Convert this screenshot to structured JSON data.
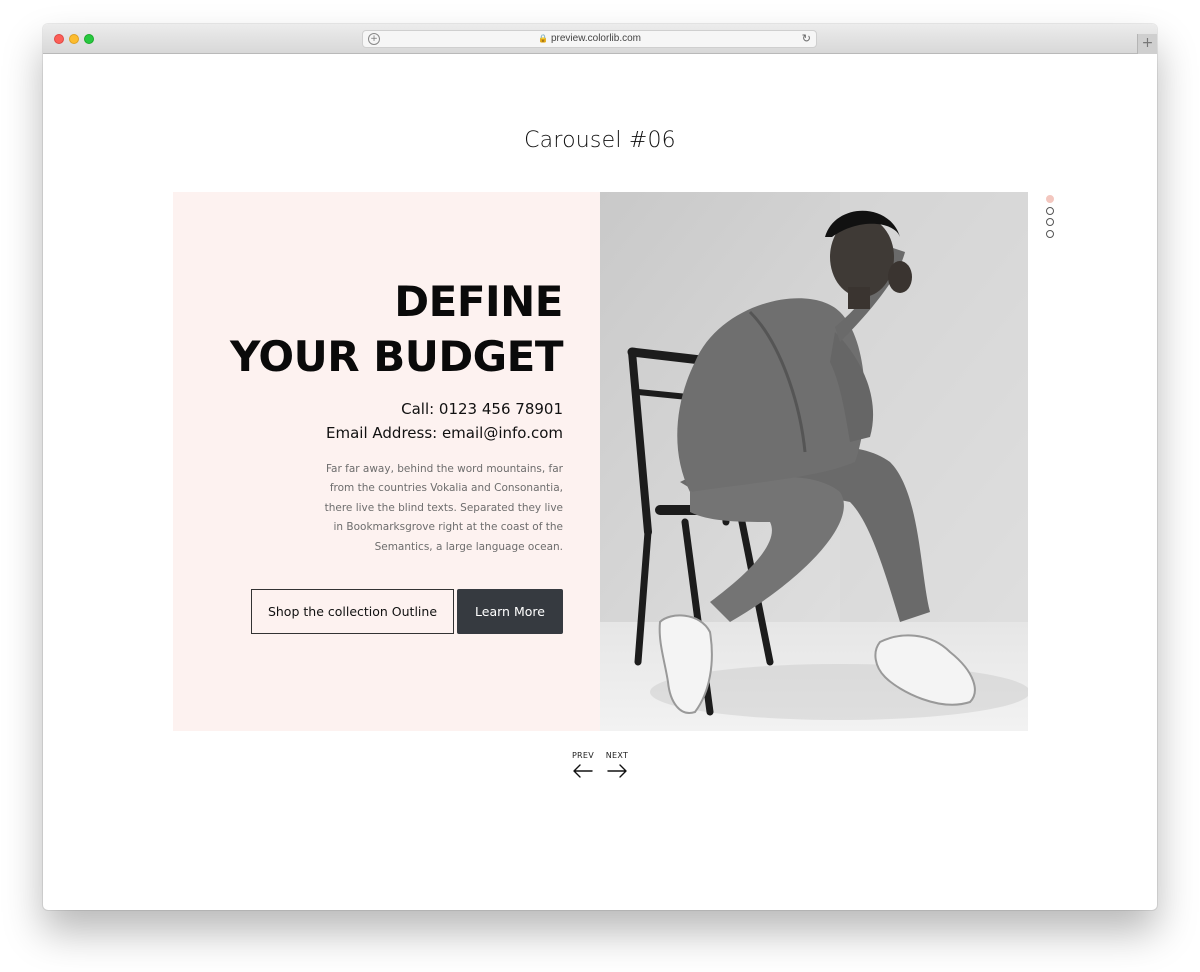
{
  "browser": {
    "url": "preview.colorlib.com",
    "new_tab_symbol": "+"
  },
  "page": {
    "heading": "Carousel #06"
  },
  "slide": {
    "title_line1": "DEFINE",
    "title_line2": "YOUR BUDGET",
    "call": "Call: 0123 456 78901",
    "email": "Email Address: email@info.com",
    "description": "Far far away, behind the word mountains, far from the countries Vokalia and Consonantia, there live the blind texts. Separated they live in Bookmarksgrove right at the coast of the Semantics, a large language ocean.",
    "button_outline": "Shop the collection Outline",
    "button_primary": "Learn More",
    "photo_icon": "woman-on-chair-photo"
  },
  "pagination": {
    "count": 4,
    "active_index": 0,
    "active_color": "#f3c7bf"
  },
  "navigation": {
    "prev_label": "PREV",
    "next_label": "NEXT",
    "prev_icon": "arrow-left-icon",
    "next_icon": "arrow-right-icon"
  },
  "colors": {
    "slide_background": "#fdf2f0",
    "primary_button": "#363a40"
  }
}
